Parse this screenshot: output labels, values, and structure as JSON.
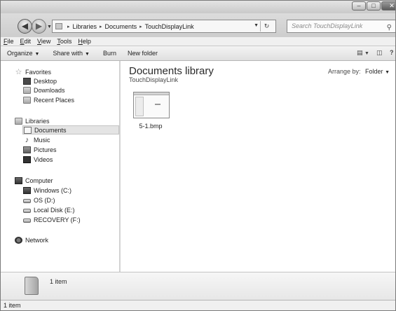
{
  "window": {
    "minimize_glyph": "–",
    "maximize_glyph": "□",
    "close_glyph": "✕"
  },
  "address": {
    "back_glyph": "◀",
    "forward_glyph": "▶",
    "dropdown_glyph": "▼",
    "separator_glyph": "▸",
    "breadcrumbs": [
      "Libraries",
      "Documents",
      "TouchDisplayLink"
    ],
    "refresh_glyph": "↻",
    "search_placeholder": "Search TouchDisplayLink",
    "search_icon_glyph": "⚲"
  },
  "menubar": {
    "items": [
      "File",
      "Edit",
      "View",
      "Tools",
      "Help"
    ]
  },
  "commandbar": {
    "organize": "Organize",
    "share_with": "Share with",
    "burn": "Burn",
    "new_folder": "New folder",
    "caret": "▼",
    "views_glyph": "▤",
    "preview_glyph": "◫",
    "help_glyph": "?"
  },
  "navpane": {
    "favorites": {
      "label": "Favorites",
      "items": [
        "Desktop",
        "Downloads",
        "Recent Places"
      ]
    },
    "libraries": {
      "label": "Libraries",
      "items": [
        "Documents",
        "Music",
        "Pictures",
        "Videos"
      ]
    },
    "computer": {
      "label": "Computer",
      "items": [
        "Windows (C:)",
        "OS (D:)",
        "Local Disk (E:)",
        "RECOVERY (F:)"
      ]
    },
    "network": {
      "label": "Network"
    },
    "selected": "Documents"
  },
  "content": {
    "title": "Documents library",
    "subtitle": "TouchDisplayLink",
    "arrange_label": "Arrange by:",
    "arrange_value": "Folder",
    "files": [
      {
        "name": "5-1.bmp"
      }
    ]
  },
  "details": {
    "count": "1 item"
  },
  "status": {
    "text": "1 item"
  }
}
